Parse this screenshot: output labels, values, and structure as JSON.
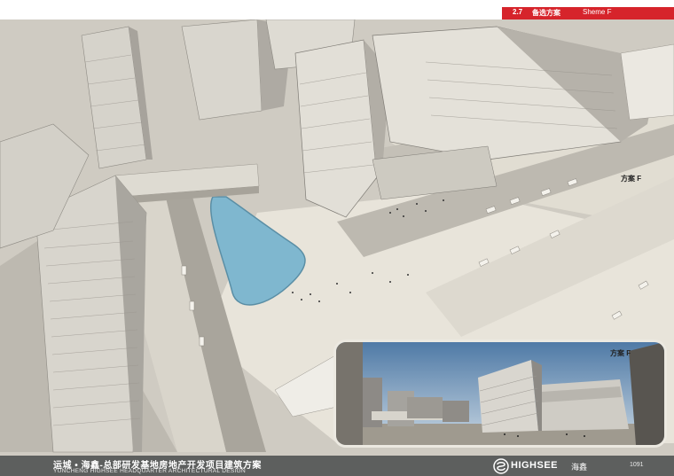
{
  "header": {
    "section_number": "2.7",
    "section_title": "备选方案",
    "section_subtitle": "Sheme F",
    "accent_color": "#d6242b"
  },
  "labels": {
    "scheme_main": "方案 F",
    "scheme_inset": "方案 F"
  },
  "footer": {
    "title_cn": "运城 • 海鑫-总部研发基地房地产开发项目建筑方案",
    "title_en": "YUNCHENG HIGHSEE HEADQUARTER ARCHITECTURAL DESIGN",
    "brand": "HIGHSEE",
    "brand_cn": "海鑫",
    "page_number": "1091",
    "bar_color": "#5d5f5e"
  }
}
